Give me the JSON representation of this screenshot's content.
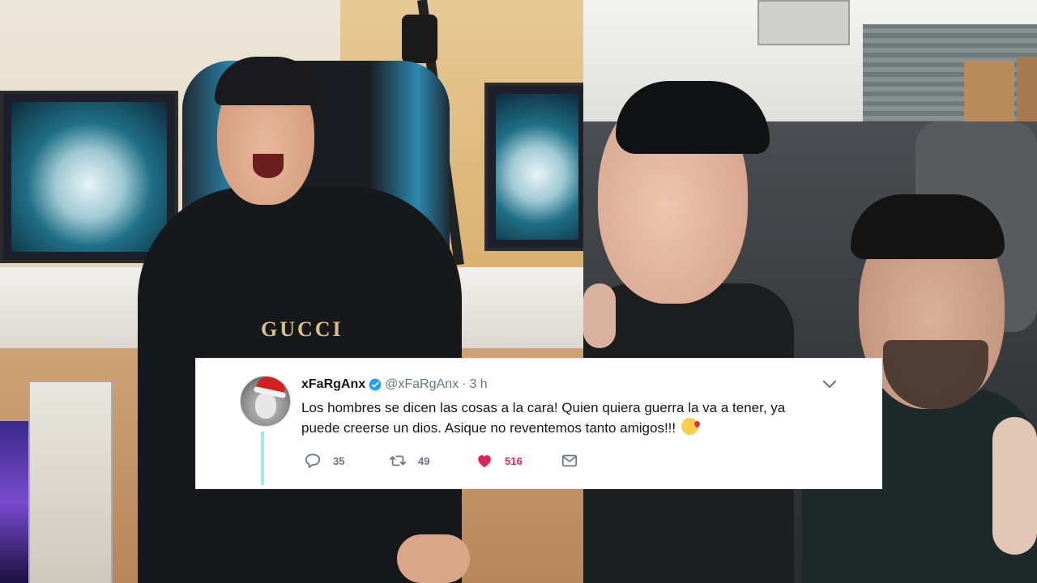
{
  "tweet": {
    "display_name": "xFaRgAnx",
    "handle": "@xFaRgAnx",
    "separator": "·",
    "time": "3 h",
    "text": "Los hombres se dicen las cosas a la cara! Quien quiera guerra la va a tener, ya puede creerse un dios. Asique no reventemos tanto amigos!!!",
    "emoji": "face-blowing-a-kiss-emoji",
    "counts": {
      "replies": "35",
      "retweets": "49",
      "likes": "516"
    },
    "liked": true,
    "verified": true,
    "icons": [
      "reply-icon",
      "retweet-icon",
      "heart-icon",
      "mail-icon",
      "chevron-down-icon",
      "verified-badge-icon"
    ],
    "colors": {
      "like": "#e0245e",
      "verified": "#1da1f2",
      "thread_line": "#a3e6f8",
      "muted": "#657786"
    }
  },
  "left_photo": {
    "shirt_text": "GUCCI"
  }
}
